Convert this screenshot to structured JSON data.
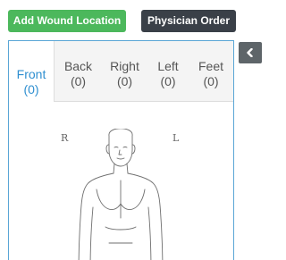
{
  "toolbar": {
    "add_wound_label": "Add Wound Location",
    "physician_order_label": "Physician Order"
  },
  "tabs": [
    {
      "label": "Front",
      "count": "(0)",
      "active": true
    },
    {
      "label": "Back",
      "count": "(0)",
      "active": false
    },
    {
      "label": "Right",
      "count": "(0)",
      "active": false
    },
    {
      "label": "Left",
      "count": "(0)",
      "active": false
    },
    {
      "label": "Feet",
      "count": "(0)",
      "active": false
    }
  ],
  "body_map": {
    "right_marker": "R",
    "left_marker": "L"
  },
  "icons": {
    "collapse": "chevron-left-icon"
  },
  "colors": {
    "add_button": "#4cb85c",
    "order_button": "#3a4048",
    "active_tab_text": "#2f8fd0",
    "panel_border": "#5aa6d6",
    "collapse_button": "#5e6569"
  }
}
